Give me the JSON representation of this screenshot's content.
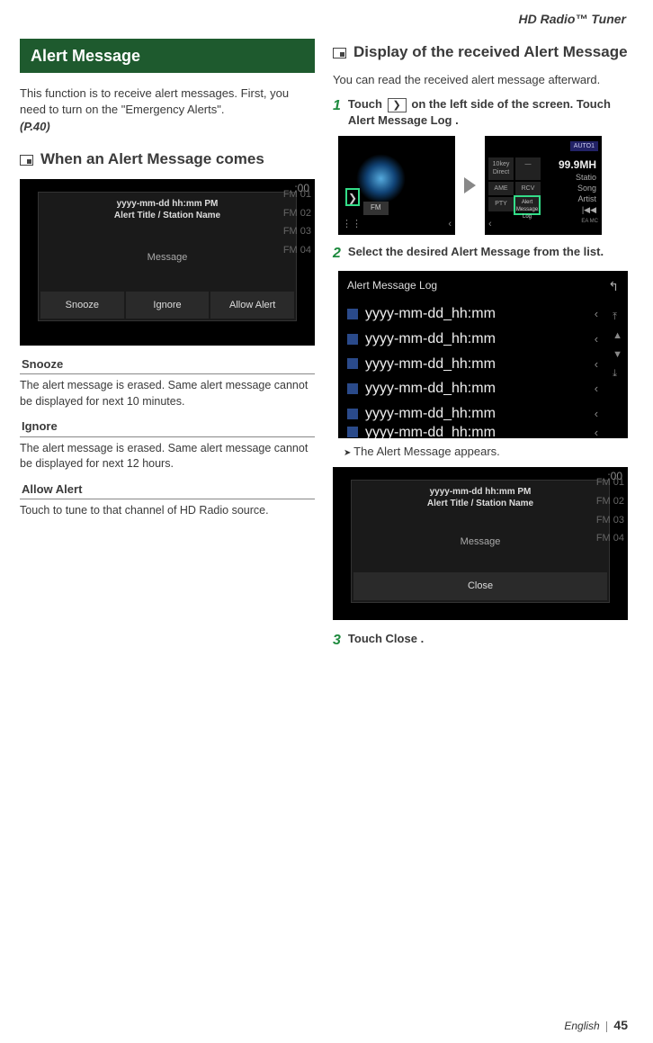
{
  "header": {
    "chapter": "HD Radio™ Tuner"
  },
  "left": {
    "title": "Alert Message",
    "intro": "This function is to receive alert messages. First, you need to turn on the \"Emergency Alerts\".",
    "ref": "(P.40)",
    "sec1": "When an Alert Message comes",
    "fig1": {
      "time": ":00",
      "header_line1": "yyyy-mm-dd hh:mm PM",
      "header_line2": "Alert Title / Station Name",
      "body": "Message",
      "btn1": "Snooze",
      "btn2": "Ignore",
      "btn3": "Allow Alert",
      "presets": [
        "FM 01",
        "FM 02",
        "FM 03",
        "FM 04"
      ]
    },
    "defs": [
      {
        "head": "Snooze",
        "body": "The alert message is erased.  Same alert message cannot be displayed for next 10 minutes."
      },
      {
        "head": "Ignore",
        "body": "The alert message is erased.  Same alert message cannot be displayed for next 12 hours."
      },
      {
        "head": "Allow Alert",
        "body": "Touch to tune to that channel of HD Radio source."
      }
    ]
  },
  "right": {
    "sec1": "Display of the received Alert Message",
    "intro": "You can read the received alert message afterward.",
    "step1": {
      "num": "1",
      "text_a": "Touch ",
      "chev": "❯",
      "text_b": " on the left side of the screen. Touch ",
      "btn": "Alert Message Log",
      "text_c": " ."
    },
    "fig_left": {
      "band": "FM",
      "chev": "❯"
    },
    "fig_right": {
      "auto": "AUTO1",
      "freq": "99.9MH",
      "meta1": "Statio",
      "meta2": "Song",
      "meta3": "Artist",
      "prev": "|◀◀",
      "btns": [
        "10key Direct",
        "—",
        "AME",
        "RCV",
        "PTY",
        ""
      ],
      "aml": "Alert Message Log",
      "ea": "EA MC"
    },
    "step2": {
      "num": "2",
      "text": "Select the desired Alert Message from the list."
    },
    "log": {
      "title": "Alert Message Log",
      "items": [
        "yyyy-mm-dd_hh:mm",
        "yyyy-mm-dd_hh:mm",
        "yyyy-mm-dd_hh:mm",
        "yyyy-mm-dd_hh:mm",
        "yyyy-mm-dd_hh:mm",
        "yyyy-mm-dd_hh:mm"
      ],
      "back": "↰",
      "side": [
        "⤒",
        "▲",
        "▼",
        "⤓"
      ]
    },
    "result": "The Alert Message appears.",
    "fig3": {
      "header_line1": "yyyy-mm-dd hh:mm PM",
      "header_line2": "Alert Title / Station Name",
      "body": "Message",
      "btn": "Close",
      "time": ":00",
      "presets": [
        "FM 01",
        "FM 02",
        "FM 03",
        "FM 04"
      ]
    },
    "step3": {
      "num": "3",
      "text_a": "Touch ",
      "btn": "Close",
      "text_b": " ."
    }
  },
  "footer": {
    "lang": "English",
    "page": "45"
  }
}
